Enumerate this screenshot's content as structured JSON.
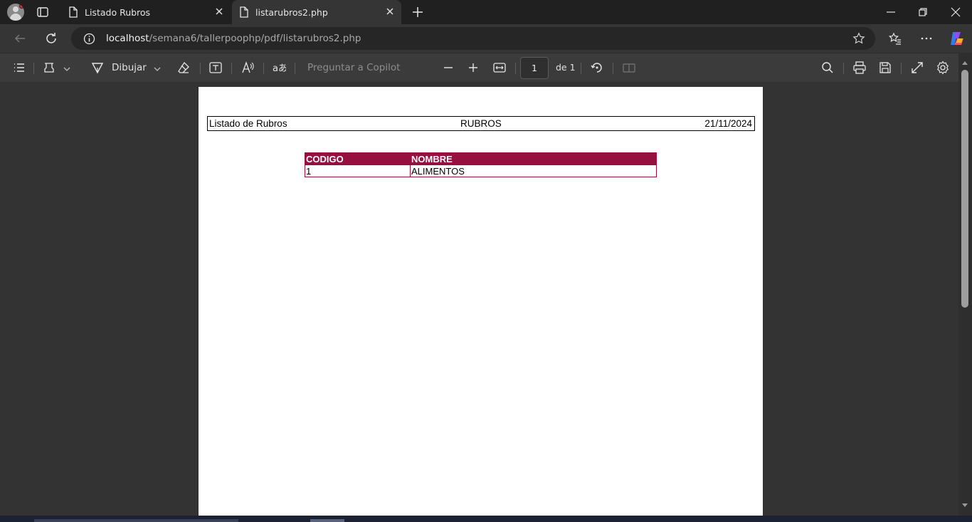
{
  "browser": {
    "tabs": [
      {
        "title": "Listado Rubros",
        "active": false
      },
      {
        "title": "listarubros2.php",
        "active": true
      }
    ],
    "url": {
      "host": "localhost",
      "path": "/semana6/tallerpoophp/pdf/listarubros2.php"
    }
  },
  "pdf_toolbar": {
    "draw_label": "Dibujar",
    "copilot_placeholder": "Preguntar a Copilot",
    "page_current": "1",
    "page_total": "de 1"
  },
  "document": {
    "header": {
      "left": "Listado de Rubros",
      "center": "RUBROS",
      "right": "21/11/2024"
    },
    "table": {
      "headers": [
        "CODIGO",
        "NOMBRE"
      ],
      "rows": [
        [
          "1",
          "ALIMENTOS"
        ]
      ]
    }
  },
  "colors": {
    "table_header_bg": "#95103f",
    "app_bg": "#202020",
    "toolbar_bg": "#3b3b3b"
  }
}
